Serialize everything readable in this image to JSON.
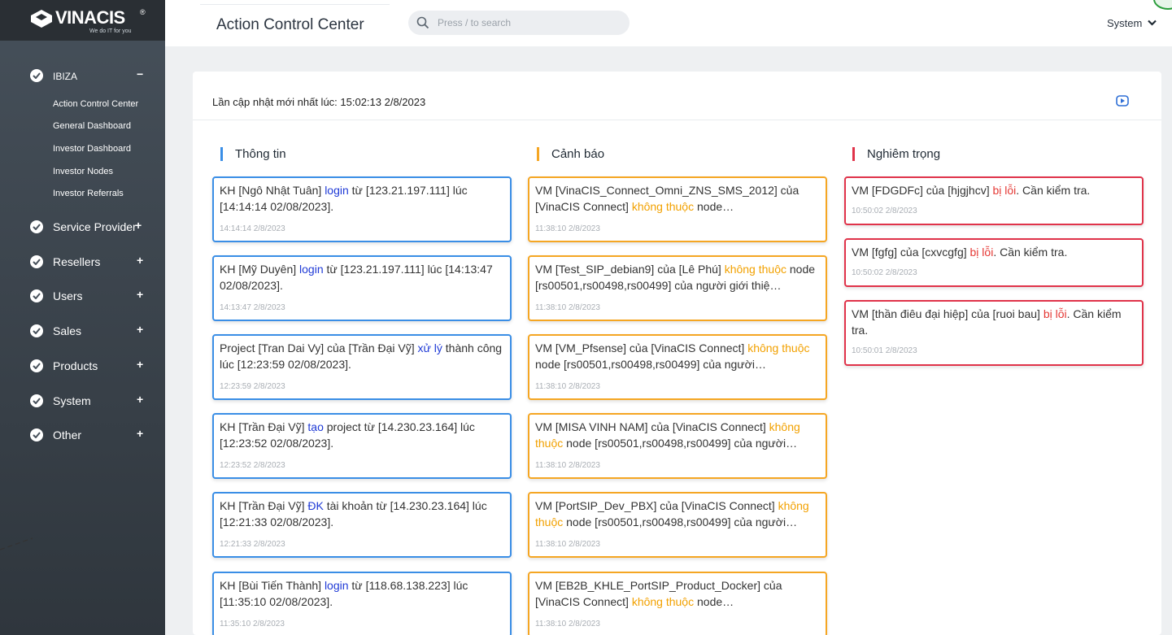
{
  "brand": {
    "name": "VINACIS",
    "reg": "®",
    "tagline": "We do IT for you"
  },
  "sidebar": {
    "group_main": {
      "label": "IBIZA",
      "toggle": "−"
    },
    "sub_items": [
      "Action Control Center",
      "General Dashboard",
      "Investor Dashboard",
      "Investor Nodes",
      "Investor Referrals"
    ],
    "groups": [
      {
        "label": "Service Provider",
        "toggle": "+"
      },
      {
        "label": "Resellers",
        "toggle": "+"
      },
      {
        "label": "Users",
        "toggle": "+"
      },
      {
        "label": "Sales",
        "toggle": "+"
      },
      {
        "label": "Products",
        "toggle": "+"
      },
      {
        "label": "System",
        "toggle": "+"
      },
      {
        "label": "Other",
        "toggle": "+"
      }
    ]
  },
  "header": {
    "title": "Action Control Center",
    "search_placeholder": "Press / to search",
    "user_menu": "System"
  },
  "panel": {
    "updated": "Lần cập nhật mới nhất lúc: 15:02:13 2/8/2023"
  },
  "columns": [
    {
      "title": "Thông tin",
      "color": "#3a8ee6"
    },
    {
      "title": "Cảnh báo",
      "color": "#f5a623"
    },
    {
      "title": "Nghiêm trọng",
      "color": "#e0334a"
    }
  ],
  "info_cards": [
    {
      "pre": "KH [Ngô Nhật Tuân] ",
      "hl": "login",
      "post": " từ [123.21.197.111] lúc [14:14:14 02/08/2023].",
      "time": "14:14:14 2/8/2023"
    },
    {
      "pre": "KH [Mỹ Duyên] ",
      "hl": "login",
      "post": " từ [123.21.197.111] lúc [14:13:47 02/08/2023].",
      "time": "14:13:47 2/8/2023"
    },
    {
      "pre": "Project [Tran Dai Vy] của [Trần Đại Vỹ] ",
      "hl": "xử lý",
      "post": " thành công lúc [12:23:59 02/08/2023].",
      "time": "12:23:59 2/8/2023"
    },
    {
      "pre": "KH [Trần Đại Vỹ] ",
      "hl": "tạo",
      "post": " project từ [14.230.23.164] lúc [12:23:52 02/08/2023].",
      "time": "12:23:52 2/8/2023"
    },
    {
      "pre": "KH [Trần Đại Vỹ] ",
      "hl": "ĐK",
      "post": " tài khoản từ [14.230.23.164] lúc [12:21:33 02/08/2023].",
      "time": "12:21:33 2/8/2023"
    },
    {
      "pre": "KH [Bùi Tiến Thành] ",
      "hl": "login",
      "post": " từ [118.68.138.223] lúc [11:35:10 02/08/2023].",
      "time": "11:35:10 2/8/2023"
    }
  ],
  "warning_cards": [
    {
      "pre": "VM [VinaCIS_Connect_Omni_ZNS_SMS_2012] của [VinaCIS Connect] ",
      "hl": "không thuộc",
      "post": " node…",
      "time": "11:38:10 2/8/2023"
    },
    {
      "pre": "VM [Test_SIP_debian9] của [Lê Phú] ",
      "hl": "không thuộc",
      "post": " node [rs00501,rs00498,rs00499] của người giới thiệ…",
      "time": "11:38:10 2/8/2023"
    },
    {
      "pre": "VM [VM_Pfsense] của [VinaCIS Connect] ",
      "hl": "không thuộc",
      "post": " node [rs00501,rs00498,rs00499] của người…",
      "time": "11:38:10 2/8/2023"
    },
    {
      "pre": "VM [MISA VINH NAM] của [VinaCIS Connect] ",
      "hl": "không thuộc",
      "post": " node [rs00501,rs00498,rs00499] của người…",
      "time": "11:38:10 2/8/2023"
    },
    {
      "pre": "VM [PortSIP_Dev_PBX] của [VinaCIS Connect] ",
      "hl": "không thuộc",
      "post": " node [rs00501,rs00498,rs00499] của người…",
      "time": "11:38:10 2/8/2023"
    },
    {
      "pre": "VM [EB2B_KHLE_PortSIP_Product_Docker] của [VinaCIS Connect] ",
      "hl": "không thuộc",
      "post": " node…",
      "time": "11:38:10 2/8/2023"
    }
  ],
  "critical_cards": [
    {
      "pre": "VM [FDGDFc] của [hjgjhcv] ",
      "hl": "bị lỗi",
      "post": ". Cần kiểm tra.",
      "time": "10:50:02 2/8/2023"
    },
    {
      "pre": "VM [fgfg] của [cxvcgfg] ",
      "hl": "bị lỗi",
      "post": ". Cần kiểm tra.",
      "time": "10:50:02 2/8/2023"
    },
    {
      "pre": "VM [thần điêu đại hiệp] của [ruoi bau] ",
      "hl": "bị lỗi",
      "post": ". Cần kiểm tra.",
      "time": "10:50:01 2/8/2023"
    }
  ]
}
